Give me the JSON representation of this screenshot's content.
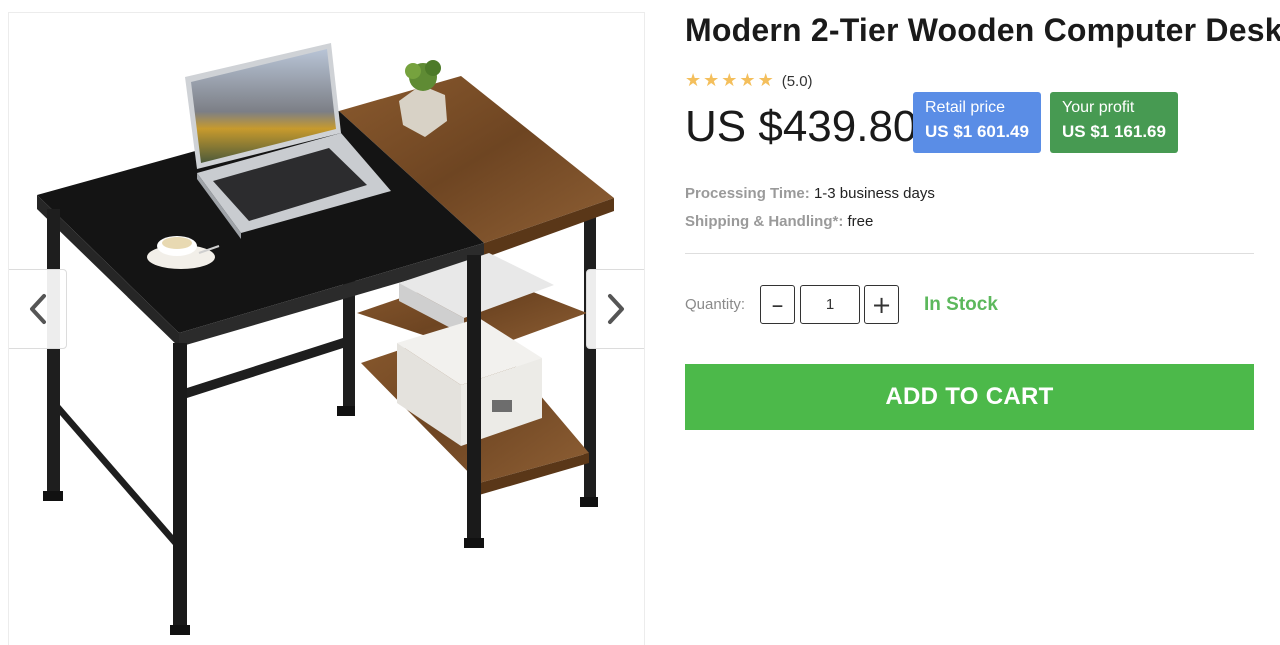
{
  "product": {
    "title": "Modern 2-Tier Wooden Computer Desk",
    "rating_text": "(5.0)",
    "rating": 5,
    "price": "US $439.80"
  },
  "badges": {
    "retail_label": "Retail price",
    "retail_value": "US $1 601.49",
    "profit_label": "Your profit",
    "profit_value": "US $1 161.69"
  },
  "details": {
    "processing_label": "Processing Time:",
    "processing_value": "1-3 business days",
    "shipping_label": "Shipping & Handling*:",
    "shipping_value": "free"
  },
  "purchase": {
    "quantity_label": "Quantity:",
    "quantity_value": "1",
    "minus_symbol": "–",
    "plus_symbol": "+",
    "stock_status": "In Stock",
    "add_to_cart_label": "ADD TO CART"
  },
  "gallery": {
    "prev_icon": "chevron-left-icon",
    "next_icon": "chevron-right-icon"
  },
  "colors": {
    "star": "#f4bf5c",
    "retail_badge": "#5a8de6",
    "profit_badge": "#479a52",
    "in_stock": "#5cb85c",
    "add_to_cart": "#4cb94a"
  }
}
